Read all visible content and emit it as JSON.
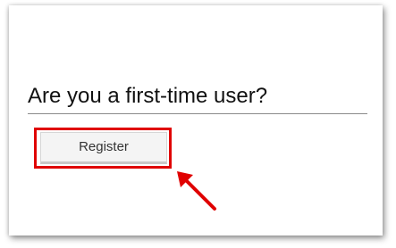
{
  "section": {
    "heading": "Are you a first-time user?",
    "register_button_label": "Register"
  },
  "annotation": {
    "highlight_color": "#e00000",
    "arrow_color": "#e00000",
    "arrow_target": "register-button"
  }
}
